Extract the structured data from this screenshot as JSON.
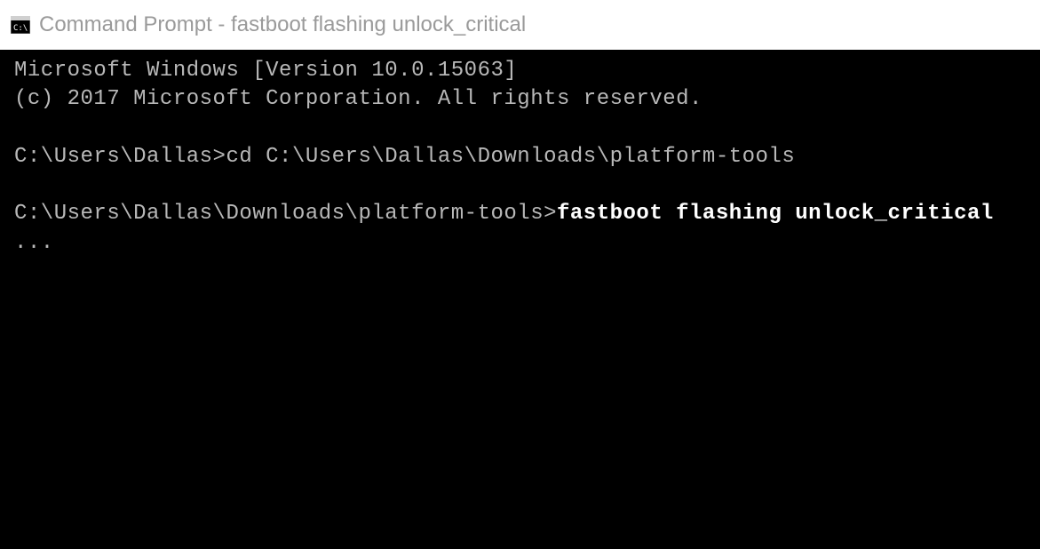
{
  "titlebar": {
    "title": "Command Prompt - fastboot  flashing unlock_critical"
  },
  "terminal": {
    "header_line1": "Microsoft Windows [Version 10.0.15063]",
    "header_line2": "(c) 2017 Microsoft Corporation. All rights reserved.",
    "prompt1": "C:\\Users\\Dallas>",
    "command1": "cd C:\\Users\\Dallas\\Downloads\\platform-tools",
    "prompt2": "C:\\Users\\Dallas\\Downloads\\platform-tools>",
    "command2": "fastboot flashing unlock_critical",
    "output": "..."
  }
}
